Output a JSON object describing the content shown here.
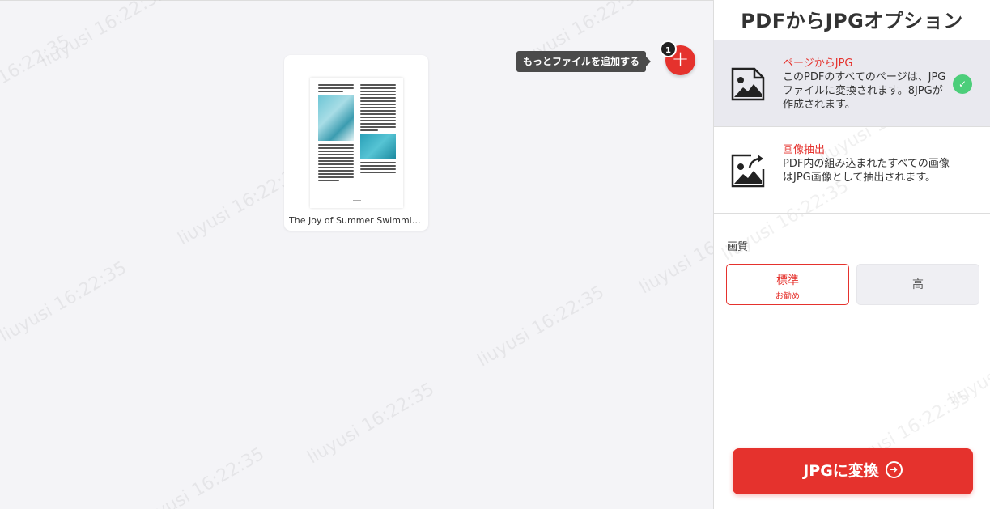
{
  "workspace": {
    "file": {
      "name": "The Joy of Summer Swimming..."
    },
    "add_more": {
      "tooltip": "もっとファイルを追加する",
      "count": "1",
      "icon": "plus-icon"
    }
  },
  "panel": {
    "title": "PDFからJPGオプション",
    "options": [
      {
        "title": "ページからJPG",
        "desc": "このPDFのすべてのページは、JPGファイルに変換されます。8JPGが作成されます。",
        "icon": "image-icon",
        "selected": true
      },
      {
        "title": "画像抽出",
        "desc": "PDF内の組み込まれたすべての画像はJPG画像として抽出されます。",
        "icon": "image-export-icon",
        "selected": false
      }
    ],
    "quality": {
      "label": "画質",
      "standard": {
        "label": "標準",
        "sub": "お勧め"
      },
      "high": {
        "label": "高"
      }
    },
    "convert": {
      "label": "JPGに変換"
    }
  },
  "watermark": {
    "text": "liuyusi 16:22:35"
  },
  "colors": {
    "accent": "#e5322d",
    "check": "#4cce7a"
  }
}
